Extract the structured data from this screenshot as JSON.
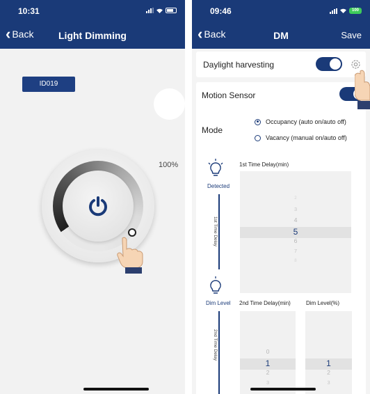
{
  "left": {
    "status_time": "10:31",
    "nav": {
      "back": "Back",
      "title": "Light Dimming"
    },
    "id_badge": "ID019",
    "brightness_percent": "100%",
    "dial_level": 1.0
  },
  "right": {
    "status_time": "09:46",
    "battery": "100",
    "nav": {
      "back": "Back",
      "title": "DM",
      "save": "Save"
    },
    "daylight_harvesting": {
      "label": "Daylight harvesting",
      "enabled": true
    },
    "motion_sensor": {
      "label": "Motion Sensor",
      "enabled": true
    },
    "mode": {
      "label": "Mode",
      "options": [
        "Occupancy (auto on/auto off)",
        "Vacancy (manual on/auto off)"
      ],
      "selected": 0
    },
    "detected_label": "Detected",
    "first_delay_side": "1st Time Delay",
    "first_delay_header": "1st Time Delay(min)",
    "first_delay_values": [
      "2",
      "3",
      "4",
      "5",
      "6",
      "7",
      "8"
    ],
    "first_delay_selected": "5",
    "dim_level_label": "Dim Level",
    "second_delay_side": "2nd Time Delay",
    "second_delay_header": "2nd Time Delay(min)",
    "second_delay_values": [
      "0",
      "1",
      "2",
      "3"
    ],
    "second_delay_selected": "1",
    "dim_level_header": "Dim Level(%)",
    "dim_level_values": [
      "1",
      "2",
      "3"
    ],
    "dim_level_selected": "1"
  },
  "colors": {
    "navy": "#1a3a78",
    "battery_green": "#3ecb5a"
  }
}
